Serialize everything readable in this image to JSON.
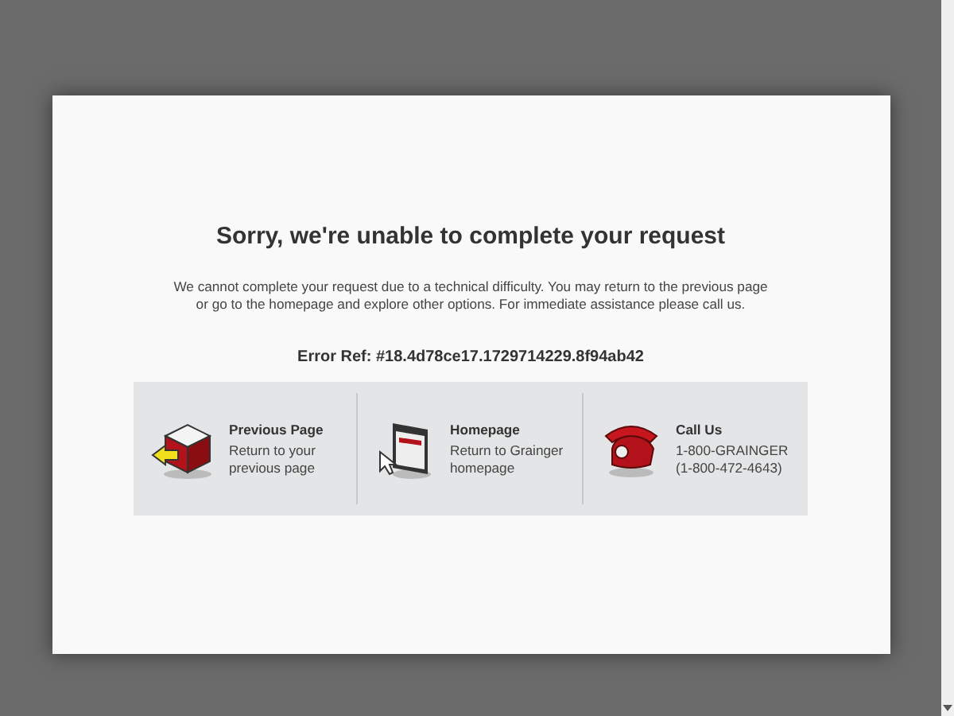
{
  "title": "Sorry, we're unable to complete your request",
  "message": "We cannot complete your request due to a technical difficulty. You may return to the previous page or go to the homepage and explore other options. For immediate assistance please call us.",
  "error_ref": "Error Ref: #18.4d78ce17.1729714229.8f94ab42",
  "options": [
    {
      "kind": "back",
      "heading": "Previous Page",
      "lines": [
        "Return to your",
        "previous page"
      ]
    },
    {
      "kind": "home",
      "heading": "Homepage",
      "lines": [
        "Return to Grainger",
        "homepage"
      ]
    },
    {
      "kind": "phone",
      "heading": "Call Us",
      "lines": [
        "1-800-GRAINGER",
        "(1-800-472-4643)"
      ]
    }
  ]
}
